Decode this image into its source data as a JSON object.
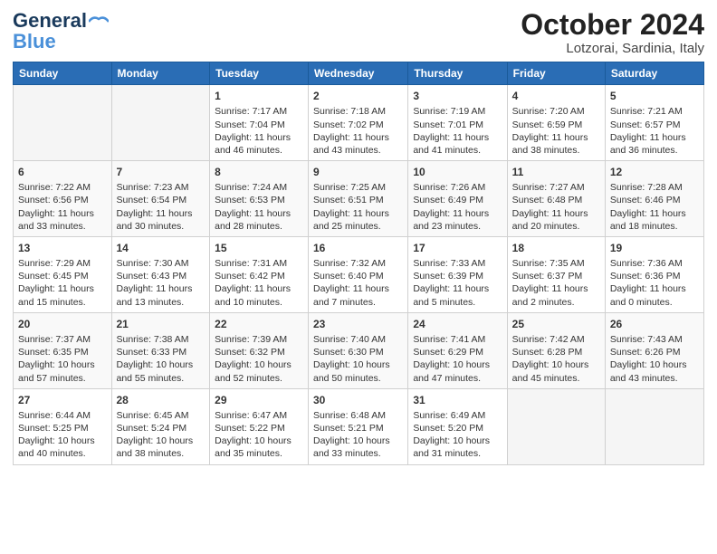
{
  "header": {
    "logo_line1": "General",
    "logo_line2": "Blue",
    "month_title": "October 2024",
    "subtitle": "Lotzorai, Sardinia, Italy"
  },
  "weekdays": [
    "Sunday",
    "Monday",
    "Tuesday",
    "Wednesday",
    "Thursday",
    "Friday",
    "Saturday"
  ],
  "weeks": [
    [
      {
        "day": "",
        "sunrise": "",
        "sunset": "",
        "daylight": ""
      },
      {
        "day": "",
        "sunrise": "",
        "sunset": "",
        "daylight": ""
      },
      {
        "day": "1",
        "sunrise": "Sunrise: 7:17 AM",
        "sunset": "Sunset: 7:04 PM",
        "daylight": "Daylight: 11 hours and 46 minutes."
      },
      {
        "day": "2",
        "sunrise": "Sunrise: 7:18 AM",
        "sunset": "Sunset: 7:02 PM",
        "daylight": "Daylight: 11 hours and 43 minutes."
      },
      {
        "day": "3",
        "sunrise": "Sunrise: 7:19 AM",
        "sunset": "Sunset: 7:01 PM",
        "daylight": "Daylight: 11 hours and 41 minutes."
      },
      {
        "day": "4",
        "sunrise": "Sunrise: 7:20 AM",
        "sunset": "Sunset: 6:59 PM",
        "daylight": "Daylight: 11 hours and 38 minutes."
      },
      {
        "day": "5",
        "sunrise": "Sunrise: 7:21 AM",
        "sunset": "Sunset: 6:57 PM",
        "daylight": "Daylight: 11 hours and 36 minutes."
      }
    ],
    [
      {
        "day": "6",
        "sunrise": "Sunrise: 7:22 AM",
        "sunset": "Sunset: 6:56 PM",
        "daylight": "Daylight: 11 hours and 33 minutes."
      },
      {
        "day": "7",
        "sunrise": "Sunrise: 7:23 AM",
        "sunset": "Sunset: 6:54 PM",
        "daylight": "Daylight: 11 hours and 30 minutes."
      },
      {
        "day": "8",
        "sunrise": "Sunrise: 7:24 AM",
        "sunset": "Sunset: 6:53 PM",
        "daylight": "Daylight: 11 hours and 28 minutes."
      },
      {
        "day": "9",
        "sunrise": "Sunrise: 7:25 AM",
        "sunset": "Sunset: 6:51 PM",
        "daylight": "Daylight: 11 hours and 25 minutes."
      },
      {
        "day": "10",
        "sunrise": "Sunrise: 7:26 AM",
        "sunset": "Sunset: 6:49 PM",
        "daylight": "Daylight: 11 hours and 23 minutes."
      },
      {
        "day": "11",
        "sunrise": "Sunrise: 7:27 AM",
        "sunset": "Sunset: 6:48 PM",
        "daylight": "Daylight: 11 hours and 20 minutes."
      },
      {
        "day": "12",
        "sunrise": "Sunrise: 7:28 AM",
        "sunset": "Sunset: 6:46 PM",
        "daylight": "Daylight: 11 hours and 18 minutes."
      }
    ],
    [
      {
        "day": "13",
        "sunrise": "Sunrise: 7:29 AM",
        "sunset": "Sunset: 6:45 PM",
        "daylight": "Daylight: 11 hours and 15 minutes."
      },
      {
        "day": "14",
        "sunrise": "Sunrise: 7:30 AM",
        "sunset": "Sunset: 6:43 PM",
        "daylight": "Daylight: 11 hours and 13 minutes."
      },
      {
        "day": "15",
        "sunrise": "Sunrise: 7:31 AM",
        "sunset": "Sunset: 6:42 PM",
        "daylight": "Daylight: 11 hours and 10 minutes."
      },
      {
        "day": "16",
        "sunrise": "Sunrise: 7:32 AM",
        "sunset": "Sunset: 6:40 PM",
        "daylight": "Daylight: 11 hours and 7 minutes."
      },
      {
        "day": "17",
        "sunrise": "Sunrise: 7:33 AM",
        "sunset": "Sunset: 6:39 PM",
        "daylight": "Daylight: 11 hours and 5 minutes."
      },
      {
        "day": "18",
        "sunrise": "Sunrise: 7:35 AM",
        "sunset": "Sunset: 6:37 PM",
        "daylight": "Daylight: 11 hours and 2 minutes."
      },
      {
        "day": "19",
        "sunrise": "Sunrise: 7:36 AM",
        "sunset": "Sunset: 6:36 PM",
        "daylight": "Daylight: 11 hours and 0 minutes."
      }
    ],
    [
      {
        "day": "20",
        "sunrise": "Sunrise: 7:37 AM",
        "sunset": "Sunset: 6:35 PM",
        "daylight": "Daylight: 10 hours and 57 minutes."
      },
      {
        "day": "21",
        "sunrise": "Sunrise: 7:38 AM",
        "sunset": "Sunset: 6:33 PM",
        "daylight": "Daylight: 10 hours and 55 minutes."
      },
      {
        "day": "22",
        "sunrise": "Sunrise: 7:39 AM",
        "sunset": "Sunset: 6:32 PM",
        "daylight": "Daylight: 10 hours and 52 minutes."
      },
      {
        "day": "23",
        "sunrise": "Sunrise: 7:40 AM",
        "sunset": "Sunset: 6:30 PM",
        "daylight": "Daylight: 10 hours and 50 minutes."
      },
      {
        "day": "24",
        "sunrise": "Sunrise: 7:41 AM",
        "sunset": "Sunset: 6:29 PM",
        "daylight": "Daylight: 10 hours and 47 minutes."
      },
      {
        "day": "25",
        "sunrise": "Sunrise: 7:42 AM",
        "sunset": "Sunset: 6:28 PM",
        "daylight": "Daylight: 10 hours and 45 minutes."
      },
      {
        "day": "26",
        "sunrise": "Sunrise: 7:43 AM",
        "sunset": "Sunset: 6:26 PM",
        "daylight": "Daylight: 10 hours and 43 minutes."
      }
    ],
    [
      {
        "day": "27",
        "sunrise": "Sunrise: 6:44 AM",
        "sunset": "Sunset: 5:25 PM",
        "daylight": "Daylight: 10 hours and 40 minutes."
      },
      {
        "day": "28",
        "sunrise": "Sunrise: 6:45 AM",
        "sunset": "Sunset: 5:24 PM",
        "daylight": "Daylight: 10 hours and 38 minutes."
      },
      {
        "day": "29",
        "sunrise": "Sunrise: 6:47 AM",
        "sunset": "Sunset: 5:22 PM",
        "daylight": "Daylight: 10 hours and 35 minutes."
      },
      {
        "day": "30",
        "sunrise": "Sunrise: 6:48 AM",
        "sunset": "Sunset: 5:21 PM",
        "daylight": "Daylight: 10 hours and 33 minutes."
      },
      {
        "day": "31",
        "sunrise": "Sunrise: 6:49 AM",
        "sunset": "Sunset: 5:20 PM",
        "daylight": "Daylight: 10 hours and 31 minutes."
      },
      {
        "day": "",
        "sunrise": "",
        "sunset": "",
        "daylight": ""
      },
      {
        "day": "",
        "sunrise": "",
        "sunset": "",
        "daylight": ""
      }
    ]
  ]
}
